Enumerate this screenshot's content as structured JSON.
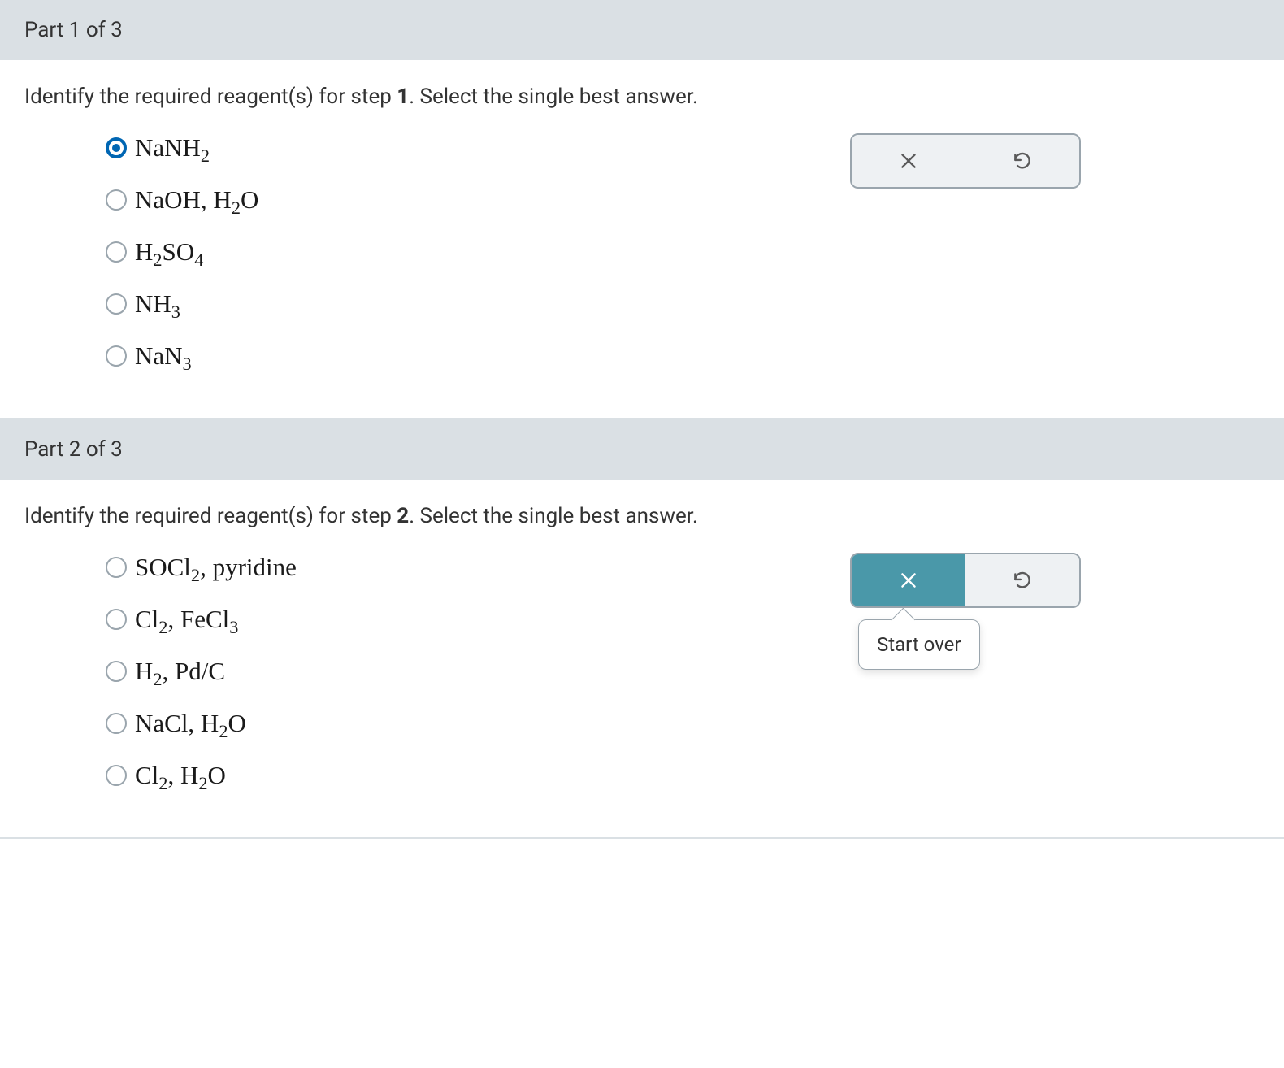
{
  "parts": [
    {
      "header": "Part 1 of 3",
      "question_prefix": "Identify the required reagent(s) for step ",
      "step_number": "1",
      "question_suffix": ". Select the single best answer.",
      "options": [
        {
          "formula_html": "NaNH<sub>2</sub>",
          "selected": true
        },
        {
          "formula_html": "NaOH, H<sub>2</sub>O",
          "selected": false
        },
        {
          "formula_html": "H<sub>2</sub>SO<sub>4</sub>",
          "selected": false
        },
        {
          "formula_html": "NH<sub>3</sub>",
          "selected": false
        },
        {
          "formula_html": "NaN<sub>3</sub>",
          "selected": false
        }
      ],
      "toolbar": {
        "clear_active": false,
        "tooltip": null
      }
    },
    {
      "header": "Part 2 of 3",
      "question_prefix": "Identify the required reagent(s) for step ",
      "step_number": "2",
      "question_suffix": ". Select the single best answer.",
      "options": [
        {
          "formula_html": "SOCl<sub>2</sub>, pyridine",
          "selected": false
        },
        {
          "formula_html": "Cl<sub>2</sub>, FeCl<sub>3</sub>",
          "selected": false
        },
        {
          "formula_html": "H<sub>2</sub>, Pd/C",
          "selected": false
        },
        {
          "formula_html": "NaCl, H<sub>2</sub>O",
          "selected": false
        },
        {
          "formula_html": "Cl<sub>2</sub>, H<sub>2</sub>O",
          "selected": false
        }
      ],
      "toolbar": {
        "clear_active": true,
        "tooltip": "Start over"
      }
    }
  ]
}
